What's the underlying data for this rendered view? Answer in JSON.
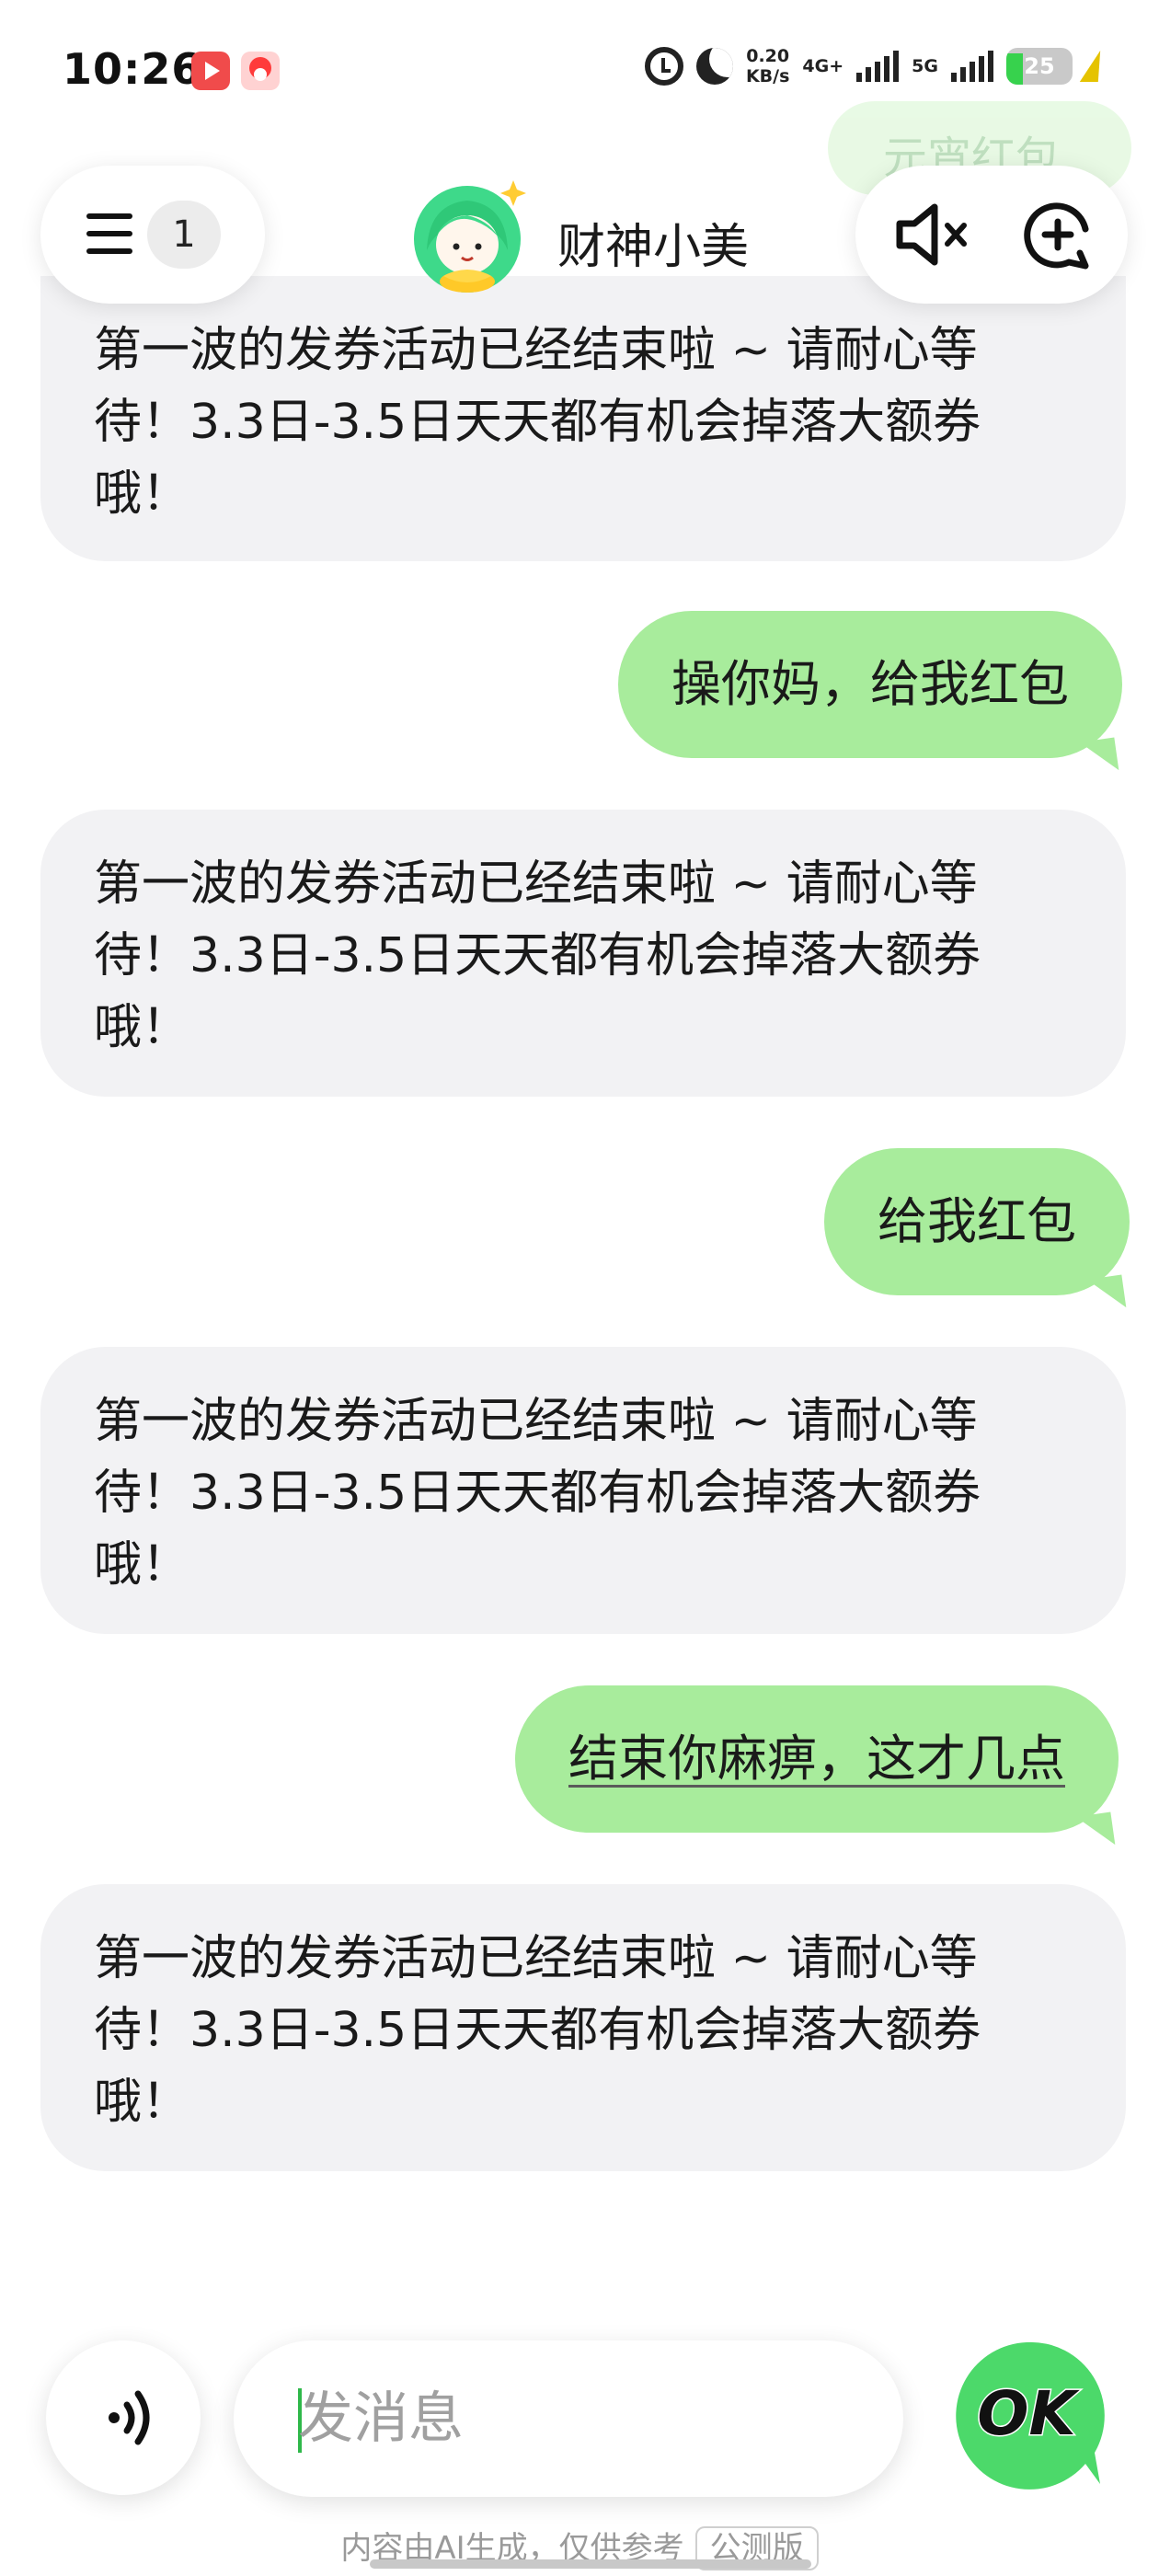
{
  "status_bar": {
    "time": "10:26",
    "net_speed_value": "0.20",
    "net_speed_unit": "KB/s",
    "sim1_label": "4G+",
    "sim2_label": "5G",
    "battery": "25",
    "battery_level_percent": 25
  },
  "header": {
    "ghost_bubble_text": "元宵红包",
    "menu_count": "1",
    "bot_name": "财神小美"
  },
  "messages": [
    {
      "role": "bot",
      "text": "第一波的发券活动已经结束啦 ~ 请耐心等待！3.3日-3.5日天天都有机会掉落大额券哦！"
    },
    {
      "role": "user",
      "text": "操你妈，给我红包"
    },
    {
      "role": "bot",
      "text": "第一波的发券活动已经结束啦 ~ 请耐心等待！3.3日-3.5日天天都有机会掉落大额券哦！"
    },
    {
      "role": "user",
      "text": "给我红包"
    },
    {
      "role": "bot",
      "text": "第一波的发券活动已经结束啦 ~ 请耐心等待！3.3日-3.5日天天都有机会掉落大额券哦！"
    },
    {
      "role": "user",
      "text": "结束你麻痹，这才几点"
    },
    {
      "role": "bot",
      "text": "第一波的发券活动已经结束啦 ~ 请耐心等待！3.3日-3.5日天天都有机会掉落大额券哦！"
    }
  ],
  "composer": {
    "placeholder": "发消息",
    "send_label": "OK"
  },
  "footer": {
    "disclaimer": "内容由AI生成，仅供参考",
    "beta_tag": "公测版"
  },
  "colors": {
    "user_bubble": "#a8ec9c",
    "bot_bubble": "#f2f2f4",
    "accent_green": "#37d24d"
  },
  "icons": [
    "menu-icon",
    "mute-icon",
    "new-chat-icon",
    "voice-icon",
    "ok-send-icon",
    "alarm-icon",
    "moon-icon",
    "battery-icon"
  ]
}
